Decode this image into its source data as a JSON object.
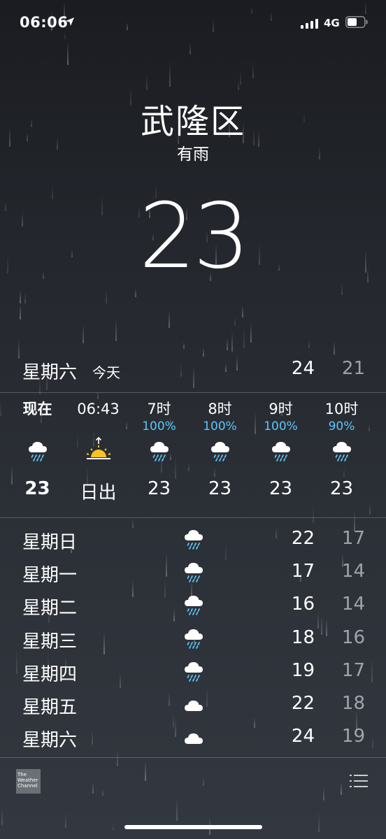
{
  "status_bar": {
    "time": "06:06",
    "network": "4G",
    "icons": [
      "location-arrow-icon",
      "signal-icon",
      "battery-icon"
    ]
  },
  "location": {
    "city": "武隆区",
    "condition": "有雨",
    "temperature": "23"
  },
  "today": {
    "day": "星期六",
    "label": "今天",
    "high": "24",
    "low": "21"
  },
  "hourly": [
    {
      "time": "现在",
      "precip": "",
      "icon": "rain-cloud-icon",
      "temp": "23"
    },
    {
      "time": "06:43",
      "precip": "",
      "icon": "sunrise-icon",
      "temp": "日出"
    },
    {
      "time": "7时",
      "precip": "100%",
      "icon": "rain-cloud-icon",
      "temp": "23"
    },
    {
      "time": "8时",
      "precip": "100%",
      "icon": "rain-cloud-icon",
      "temp": "23"
    },
    {
      "time": "9时",
      "precip": "100%",
      "icon": "rain-cloud-icon",
      "temp": "23"
    },
    {
      "time": "10时",
      "precip": "90%",
      "icon": "rain-cloud-icon",
      "temp": "23"
    }
  ],
  "daily": [
    {
      "day": "星期日",
      "icon": "rain-cloud-icon",
      "high": "22",
      "low": "17"
    },
    {
      "day": "星期一",
      "icon": "rain-cloud-icon",
      "high": "17",
      "low": "14"
    },
    {
      "day": "星期二",
      "icon": "rain-cloud-icon",
      "high": "16",
      "low": "14"
    },
    {
      "day": "星期三",
      "icon": "rain-cloud-icon",
      "high": "18",
      "low": "16"
    },
    {
      "day": "星期四",
      "icon": "rain-cloud-icon",
      "high": "19",
      "low": "17"
    },
    {
      "day": "星期五",
      "icon": "cloud-icon",
      "high": "22",
      "low": "18"
    },
    {
      "day": "星期六",
      "icon": "cloud-icon",
      "high": "24",
      "low": "19"
    }
  ],
  "footer": {
    "logo_text": "The Weather Channel",
    "list_icon": "list-icon"
  },
  "colors": {
    "precip_blue": "#5ac8fa",
    "sun_yellow": "#f7c325",
    "rain_drop_blue": "#5ac8fa"
  }
}
